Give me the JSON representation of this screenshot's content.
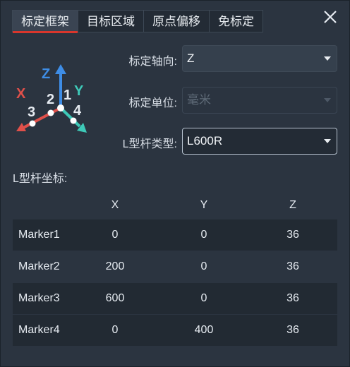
{
  "tabs": [
    "标定框架",
    "目标区域",
    "原点偏移",
    "免标定"
  ],
  "active_tab": "标定框架",
  "axis_illustration": {
    "z_label": "Z",
    "y_label": "Y",
    "x_label": "X",
    "n1": "1",
    "n2": "2",
    "n3": "3",
    "n4": "4"
  },
  "form": {
    "axis_direction": {
      "label": "标定轴向:",
      "value": "Z"
    },
    "unit": {
      "label": "标定单位:",
      "value": "毫米",
      "disabled": true
    },
    "rod_type": {
      "label": "L型杆类型:",
      "value": "L600R"
    }
  },
  "coords_label": "L型杆坐标:",
  "table": {
    "columns": [
      "",
      "X",
      "Y",
      "Z"
    ],
    "rows": [
      [
        "Marker1",
        "0",
        "0",
        "36"
      ],
      [
        "Marker2",
        "200",
        "0",
        "36"
      ],
      [
        "Marker3",
        "600",
        "0",
        "36"
      ],
      [
        "Marker4",
        "0",
        "400",
        "36"
      ]
    ]
  },
  "colors": {
    "accent_red": "#d9362c",
    "axis_x": "#e0504a",
    "axis_y": "#3ec9b8",
    "axis_z": "#3e8de6"
  }
}
